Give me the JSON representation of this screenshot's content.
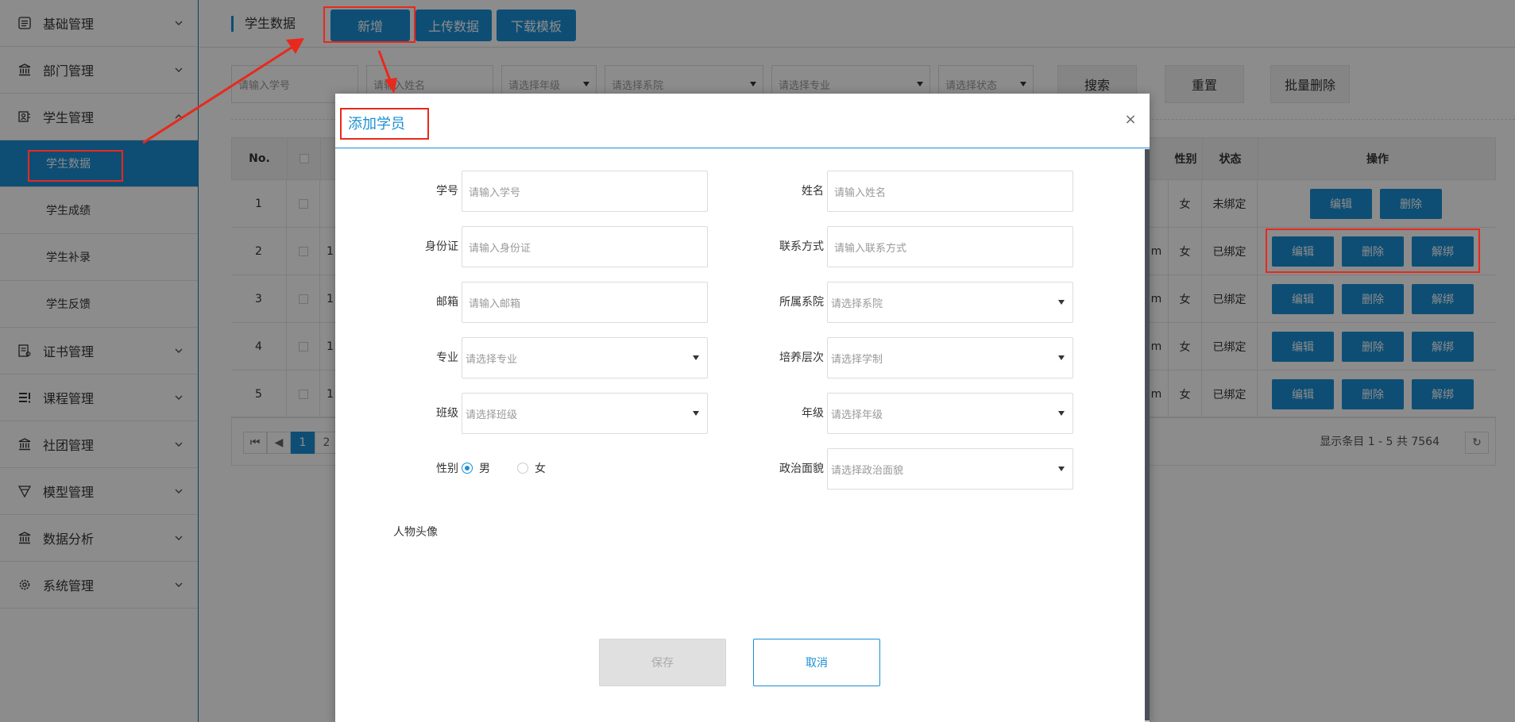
{
  "sidebar": {
    "items": [
      {
        "label": "基础管理",
        "icon": "list-icon"
      },
      {
        "label": "部门管理",
        "icon": "building-icon"
      },
      {
        "label": "学生管理",
        "icon": "student-icon"
      },
      {
        "label": "证书管理",
        "icon": "certificate-icon"
      },
      {
        "label": "课程管理",
        "icon": "course-icon"
      },
      {
        "label": "社团管理",
        "icon": "building-icon"
      },
      {
        "label": "模型管理",
        "icon": "funnel-icon"
      },
      {
        "label": "数据分析",
        "icon": "building-icon"
      },
      {
        "label": "系统管理",
        "icon": "gear-icon"
      }
    ],
    "sub_items": [
      "学生数据",
      "学生成绩",
      "学生补录",
      "学生反馈"
    ]
  },
  "header": {
    "breadcrumb": "学生数据",
    "add_label": "新增",
    "upload_label": "上传数据",
    "download_label": "下载模板"
  },
  "filters": {
    "student_id_placeholder": "请输入学号",
    "name_placeholder": "请输入姓名",
    "grade_placeholder": "请选择年级",
    "dept_placeholder": "请选择系院",
    "major_placeholder": "请选择专业",
    "status_placeholder": "请选择状态",
    "search_label": "搜索",
    "reset_label": "重置",
    "batch_delete_label": "批量删除"
  },
  "table": {
    "columns": {
      "no": "No.",
      "gender": "性别",
      "status": "状态",
      "ops": "操作"
    },
    "rows": [
      {
        "no": "1",
        "partial": "",
        "partial2": "",
        "gender": "女",
        "status": "未绑定",
        "bound": false
      },
      {
        "no": "2",
        "partial": "1",
        "partial2": "m",
        "gender": "女",
        "status": "已绑定",
        "bound": true
      },
      {
        "no": "3",
        "partial": "1",
        "partial2": "m",
        "gender": "女",
        "status": "已绑定",
        "bound": true
      },
      {
        "no": "4",
        "partial": "1",
        "partial2": "m",
        "gender": "女",
        "status": "已绑定",
        "bound": true
      },
      {
        "no": "5",
        "partial": "1",
        "partial2": "m",
        "gender": "女",
        "status": "已绑定",
        "bound": true
      }
    ],
    "edit_label": "编辑",
    "delete_label": "删除",
    "unbind_label": "解绑"
  },
  "pager": {
    "pages": [
      "1",
      "2"
    ],
    "current": "1",
    "summary": "显示条目 1 - 5 共 7564"
  },
  "modal": {
    "title": "添加学员",
    "close": "×",
    "fields": {
      "student_id": {
        "label": "学号",
        "placeholder": "请输入学号"
      },
      "name": {
        "label": "姓名",
        "placeholder": "请输入姓名"
      },
      "id_card": {
        "label": "身份证",
        "placeholder": "请输入身份证"
      },
      "contact": {
        "label": "联系方式",
        "placeholder": "请输入联系方式"
      },
      "email": {
        "label": "邮箱",
        "placeholder": "请输入邮箱"
      },
      "dept": {
        "label": "所属系院",
        "placeholder": "请选择系院"
      },
      "major": {
        "label": "专业",
        "placeholder": "请选择专业"
      },
      "level": {
        "label": "培养层次",
        "placeholder": "请选择学制"
      },
      "class": {
        "label": "班级",
        "placeholder": "请选择班级"
      },
      "grade": {
        "label": "年级",
        "placeholder": "请选择年级"
      },
      "gender": {
        "label": "性别",
        "male": "男",
        "female": "女",
        "selected": "男"
      },
      "politics": {
        "label": "政治面貌",
        "placeholder": "请选择政治面貌"
      },
      "avatar": {
        "label": "人物头像"
      }
    },
    "save_label": "保存",
    "cancel_label": "取消"
  },
  "colors": {
    "accent": "#1a8fd4",
    "annotation": "#e8291c"
  }
}
